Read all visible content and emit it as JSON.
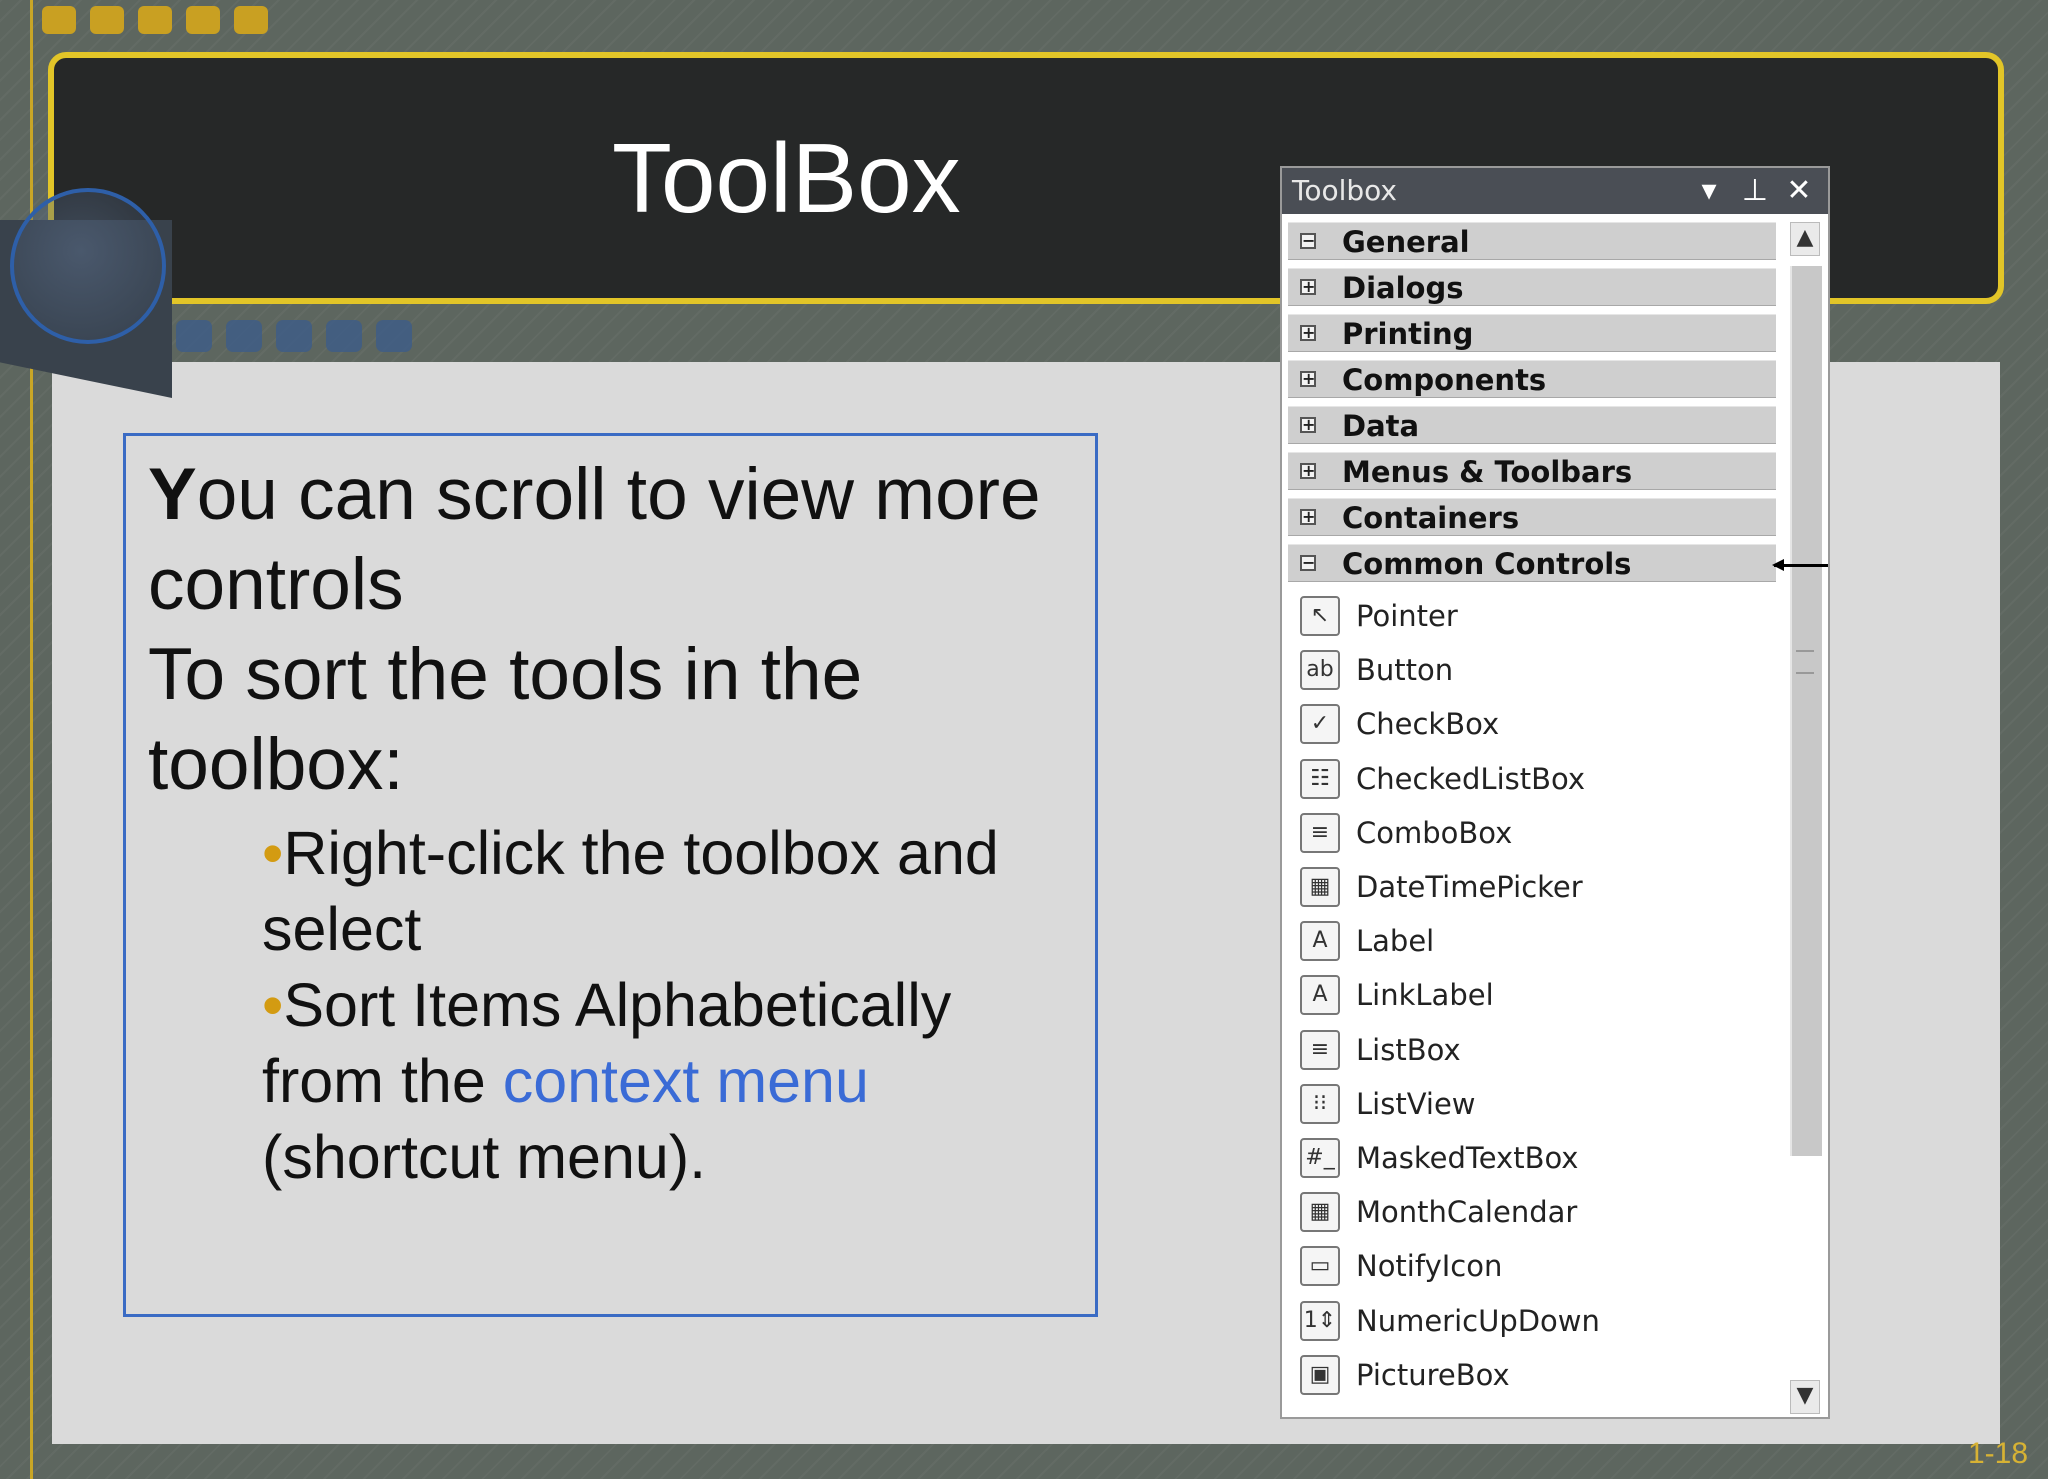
{
  "slide": {
    "title": "ToolBox",
    "slide_number": "1-18",
    "body": {
      "line1_first": "Y",
      "line1_rest": "ou can scroll to view more",
      "line2": "controls",
      "line3": "To sort the tools in the",
      "line4": "toolbox:",
      "bullet_char": "•",
      "bullet1_line1": "Right-click the toolbox and",
      "bullet1_line2": "select",
      "bullet2_line1": "Sort Items Alphabetically",
      "bullet2_line2_prefix": "from the ",
      "bullet2_link": "context menu",
      "bullet2_line3": "(shortcut menu)."
    }
  },
  "colors": {
    "title_band_border": "#e2c528",
    "title_band_bg": "#262828",
    "text_box_border": "#3a6bc4",
    "link": "#3a6bd6",
    "bullet": "#d39b12"
  },
  "toolbox": {
    "title": "Toolbox",
    "buttons": {
      "dropdown": "▾",
      "pin": "⊥",
      "close": "✕"
    },
    "categories": [
      {
        "label": "General",
        "state": "−"
      },
      {
        "label": "Dialogs",
        "state": "+"
      },
      {
        "label": "Printing",
        "state": "+"
      },
      {
        "label": "Components",
        "state": "+"
      },
      {
        "label": "Data",
        "state": "+"
      },
      {
        "label": "Menus & Toolbars",
        "state": "+"
      },
      {
        "label": "Containers",
        "state": "+"
      },
      {
        "label": "Common Controls",
        "state": "−"
      }
    ],
    "items": [
      {
        "label": "Pointer",
        "icon": "pointer-icon",
        "glyph": "↖"
      },
      {
        "label": "Button",
        "icon": "button-icon",
        "glyph": "ab"
      },
      {
        "label": "CheckBox",
        "icon": "checkbox-icon",
        "glyph": "✓"
      },
      {
        "label": "CheckedListBox",
        "icon": "checkedlistbox-icon",
        "glyph": "☷"
      },
      {
        "label": "ComboBox",
        "icon": "combobox-icon",
        "glyph": "≡"
      },
      {
        "label": "DateTimePicker",
        "icon": "datetimepicker-icon",
        "glyph": "▦"
      },
      {
        "label": "Label",
        "icon": "label-icon",
        "glyph": "A"
      },
      {
        "label": "LinkLabel",
        "icon": "linklabel-icon",
        "glyph": "A"
      },
      {
        "label": "ListBox",
        "icon": "listbox-icon",
        "glyph": "≡"
      },
      {
        "label": "ListView",
        "icon": "listview-icon",
        "glyph": "⁝⁝"
      },
      {
        "label": "MaskedTextBox",
        "icon": "maskedtextbox-icon",
        "glyph": "#_"
      },
      {
        "label": "MonthCalendar",
        "icon": "monthcalendar-icon",
        "glyph": "▦"
      },
      {
        "label": "NotifyIcon",
        "icon": "notifyicon-icon",
        "glyph": "▭"
      },
      {
        "label": "NumericUpDown",
        "icon": "numericupdown-icon",
        "glyph": "1⇕"
      },
      {
        "label": "PictureBox",
        "icon": "picturebox-icon",
        "glyph": "▣"
      }
    ],
    "scroll": {
      "up": "▲",
      "down": "▼"
    }
  }
}
